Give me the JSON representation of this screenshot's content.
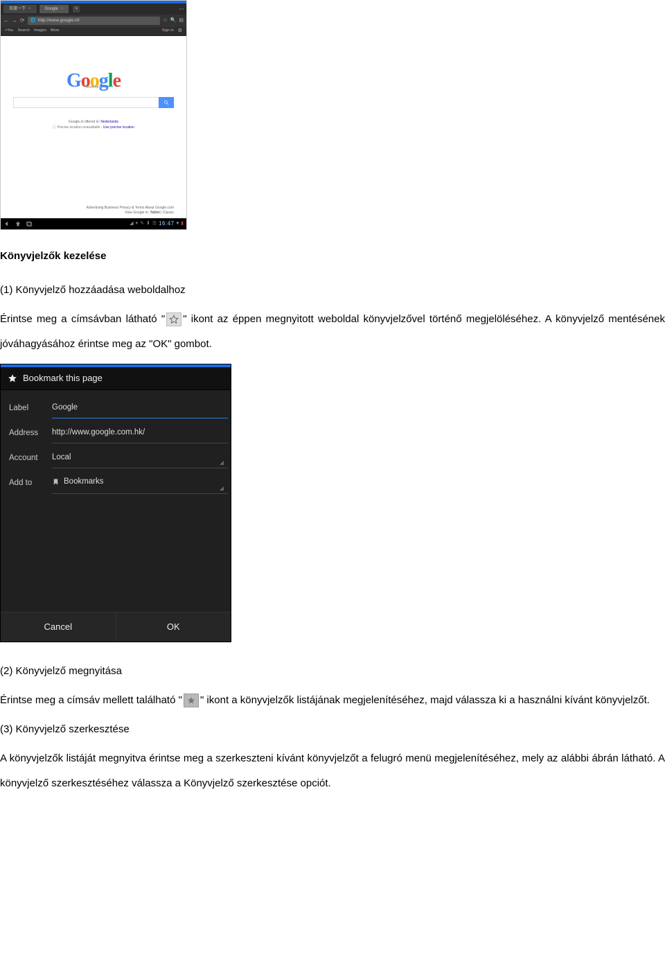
{
  "screenshot1": {
    "tabs": {
      "left_label": "百度一下",
      "active_label": "Google"
    },
    "url": "http://www.google.nl/",
    "google_bar": {
      "left": [
        "+You",
        "Search",
        "Images",
        "More"
      ],
      "signin": "Sign in"
    },
    "logo_sub": "Nederland",
    "offered_prefix": "Google.nl offered in: ",
    "offered_lang": "Nederlands",
    "precise_prefix": "Precise location unavailable - ",
    "precise_link": "Use precise location",
    "footer_line1": "Advertising   Business   Privacy & Terms   About   Google.com",
    "footer_line2_a": "View Google in: ",
    "footer_line2_b": "Tablet",
    "footer_line2_c": " | Classic",
    "status_time": "16:47"
  },
  "section_title": "Könyvjelzők kezelése",
  "item1_label": "(1)  Könyvjelző hozzáadása weboldalhoz",
  "para1_a": "Érintse meg a címsávban látható \"",
  "para1_b": "\" ikont az éppen megnyitott weboldal könyvjelzővel történő megjelöléséhez. A könyvjelző mentésének jóváhagyásához érintse meg az \"OK\" gombot.",
  "screenshot2": {
    "title": "Bookmark this page",
    "labels": {
      "label": "Label",
      "address": "Address",
      "account": "Account",
      "addto": "Add to"
    },
    "values": {
      "label": "Google",
      "address": "http://www.google.com.hk/",
      "account": "Local",
      "addto": "Bookmarks"
    },
    "buttons": {
      "cancel": "Cancel",
      "ok": "OK"
    }
  },
  "item2_label": "(2)  Könyvjelző megnyitása",
  "para2_a": "Érintse meg a címsáv mellett található \"",
  "para2_b": "\" ikont a könyvjelzők listájának megjelenítéséhez, majd válassza ki a használni kívánt könyvjelzőt.",
  "item3_label": "(3)  Könyvjelző szerkesztése",
  "para3": "A könyvjelzők listáját megnyitva érintse meg a szerkeszteni kívánt könyvjelzőt a felugró menü megjelenítéséhez, mely az alábbi ábrán látható. A könyvjelző szerkesztéséhez válassza a Könyvjelző szerkesztése opciót."
}
